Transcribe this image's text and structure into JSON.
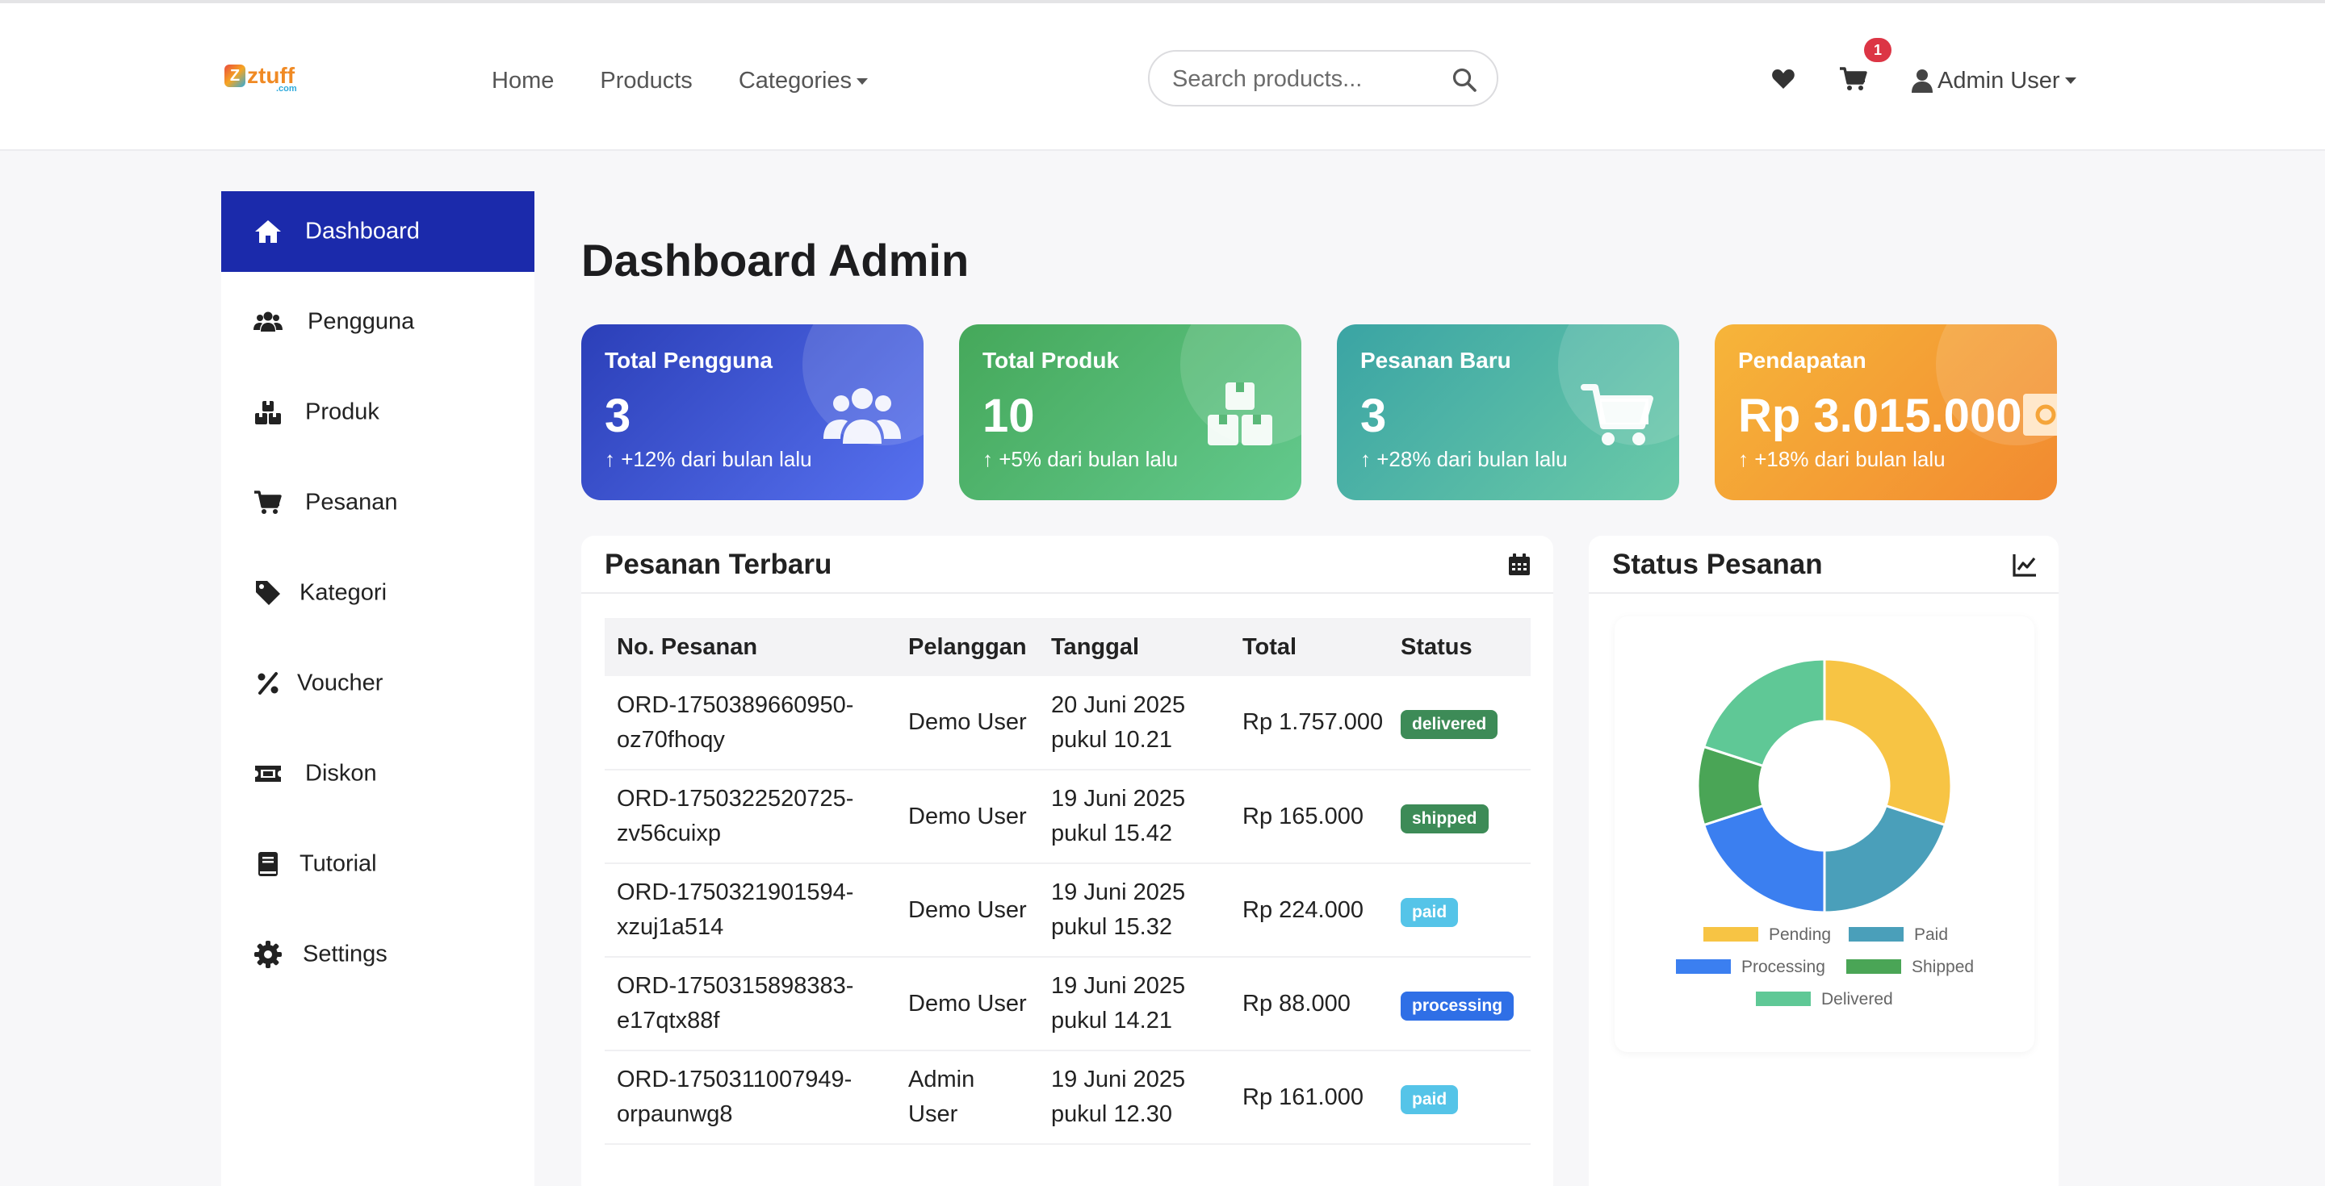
{
  "brand": {
    "mark": "Z",
    "name": "ztuff",
    "sub": ".com"
  },
  "nav": {
    "links": [
      "Home",
      "Products",
      "Categories"
    ],
    "search_placeholder": "Search products...",
    "cart_count": "1",
    "user_label": "Admin User"
  },
  "sidebar": {
    "items": [
      {
        "label": "Dashboard",
        "icon": "home-icon"
      },
      {
        "label": "Pengguna",
        "icon": "users-icon"
      },
      {
        "label": "Produk",
        "icon": "boxes-icon"
      },
      {
        "label": "Pesanan",
        "icon": "cart-icon"
      },
      {
        "label": "Kategori",
        "icon": "tag-icon"
      },
      {
        "label": "Voucher",
        "icon": "percent-icon"
      },
      {
        "label": "Diskon",
        "icon": "ticket-icon"
      },
      {
        "label": "Tutorial",
        "icon": "book-icon"
      },
      {
        "label": "Settings",
        "icon": "gear-icon"
      }
    ]
  },
  "page_title": "Dashboard Admin",
  "stats": [
    {
      "label": "Total Pengguna",
      "value": "3",
      "change": "+12% dari bulan lalu",
      "icon": "users-icon",
      "colors": [
        "#2b3fb8",
        "#5771ef"
      ]
    },
    {
      "label": "Total Produk",
      "value": "10",
      "change": "+5% dari bulan lalu",
      "icon": "boxes-icon",
      "colors": [
        "#45a85a",
        "#63c98d"
      ]
    },
    {
      "label": "Pesanan Baru",
      "value": "3",
      "change": "+28% dari bulan lalu",
      "icon": "cart-icon",
      "colors": [
        "#3aa4a4",
        "#6bcaa8"
      ]
    },
    {
      "label": "Pendapatan",
      "value": "Rp 3.015.000",
      "change": "+18% dari bulan lalu",
      "icon": "money-icon",
      "colors": [
        "#f6b53a",
        "#f28a30"
      ]
    }
  ],
  "orders": {
    "title": "Pesanan Terbaru",
    "icon": "calendar-icon",
    "columns": [
      "No. Pesanan",
      "Pelanggan",
      "Tanggal",
      "Total",
      "Status"
    ],
    "rows": [
      {
        "id": [
          "ORD-1750389660950-",
          "oz70fhoqy"
        ],
        "customer": [
          "Demo User"
        ],
        "date": [
          "20 Juni 2025",
          "pukul 10.21"
        ],
        "total": "Rp 1.757.000",
        "status": "delivered",
        "status_color": "#3d8b57"
      },
      {
        "id": [
          "ORD-1750322520725-",
          "zv56cuixp"
        ],
        "customer": [
          "Demo User"
        ],
        "date": [
          "19 Juni 2025",
          "pukul 15.42"
        ],
        "total": "Rp 165.000",
        "status": "shipped",
        "status_color": "#3d8b57"
      },
      {
        "id": [
          "ORD-1750321901594-",
          "xzuj1a514"
        ],
        "customer": [
          "Demo User"
        ],
        "date": [
          "19 Juni 2025",
          "pukul 15.32"
        ],
        "total": "Rp 224.000",
        "status": "paid",
        "status_color": "#55c4e8"
      },
      {
        "id": [
          "ORD-1750315898383-",
          "e17qtx88f"
        ],
        "customer": [
          "Demo User"
        ],
        "date": [
          "19 Juni 2025",
          "pukul 14.21"
        ],
        "total": "Rp 88.000",
        "status": "processing",
        "status_color": "#2f6fe6"
      },
      {
        "id": [
          "ORD-1750311007949-",
          "orpaunwg8"
        ],
        "customer": [
          "Admin",
          "User"
        ],
        "date": [
          "19 Juni 2025",
          "pukul 12.30"
        ],
        "total": "Rp 161.000",
        "status": "paid",
        "status_color": "#55c4e8"
      }
    ]
  },
  "status_card": {
    "title": "Status Pesanan",
    "icon": "chart-line-icon"
  },
  "chart_data": {
    "type": "pie",
    "donut": true,
    "categories": [
      "Pending",
      "Paid",
      "Processing",
      "Shipped",
      "Delivered"
    ],
    "values": [
      30,
      20,
      20,
      10,
      20
    ],
    "colors": [
      "#f7c444",
      "#4a9fba",
      "#3b7ff0",
      "#4aa556",
      "#5fc896"
    ],
    "legend_position": "bottom"
  }
}
